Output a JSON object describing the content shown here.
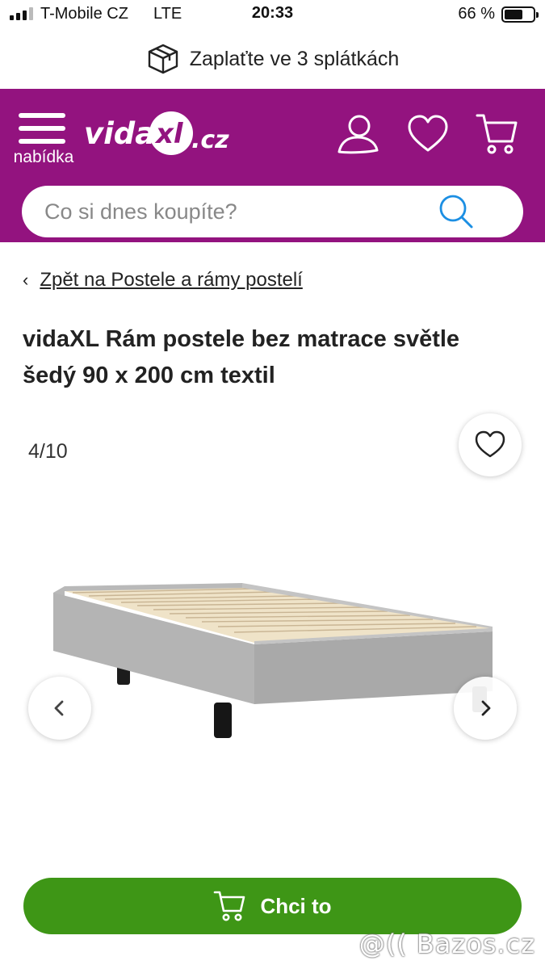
{
  "status_bar": {
    "carrier": "T-Mobile CZ",
    "network": "LTE",
    "time": "20:33",
    "battery_percent": "66 %",
    "battery_level": 0.66
  },
  "banner": {
    "icon": "package-icon",
    "text": "Zaplaťte ve 3 splátkách"
  },
  "header": {
    "menu_label": "nabídka",
    "logo_text": "vidaXL.cz",
    "icons": [
      "account-icon",
      "heart-icon",
      "cart-icon"
    ],
    "brand_color": "#93137f"
  },
  "search": {
    "placeholder": "Co si dnes koupíte?",
    "value": "",
    "icon": "search-icon",
    "icon_color": "#1c8fe3"
  },
  "breadcrumb": {
    "back_label": "Zpět na Postele a rámy postelí"
  },
  "product": {
    "title": "vidaXL Rám postele bez matrace světle šedý 90 x 200 cm textil",
    "image_counter": "4/10",
    "image_subject": "bed-frame"
  },
  "cta": {
    "label": "Chci to",
    "icon": "cart-icon",
    "color": "#3e9616"
  },
  "watermark": {
    "text": "@(( Bazos.cz"
  }
}
